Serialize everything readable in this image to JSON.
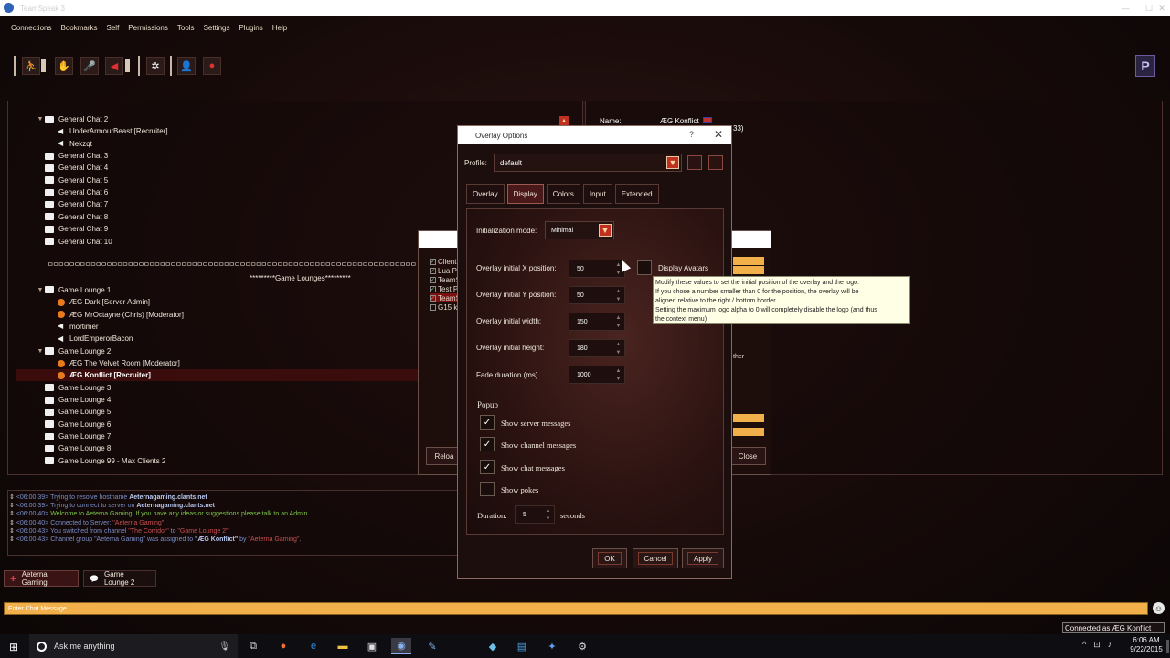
{
  "window": {
    "title": "TeamSpeak 3"
  },
  "menu": [
    "Connections",
    "Bookmarks",
    "Self",
    "Permissions",
    "Tools",
    "Settings",
    "Plugins",
    "Help"
  ],
  "toolbar": {
    "icons": [
      "connect-icon",
      "away-icon",
      "mic-mute-icon",
      "speaker-mute-icon",
      "settings-icon",
      "contacts-icon",
      "record-icon"
    ]
  },
  "pbutton": "P",
  "tree": [
    {
      "type": "channel",
      "label": "General Chat 2",
      "indent": 0,
      "expand": "▼"
    },
    {
      "type": "user",
      "label": "UnderArmourBeast [Recruiter]",
      "indent": 1
    },
    {
      "type": "user",
      "label": "Nekzqt",
      "indent": 1
    },
    {
      "type": "channel",
      "label": "General Chat 3",
      "indent": 0
    },
    {
      "type": "channel",
      "label": "General Chat 4",
      "indent": 0
    },
    {
      "type": "channel",
      "label": "General Chat 5",
      "indent": 0
    },
    {
      "type": "channel",
      "label": "General Chat 6",
      "indent": 0
    },
    {
      "type": "channel",
      "label": "General Chat 7",
      "indent": 0
    },
    {
      "type": "channel",
      "label": "General Chat 8",
      "indent": 0
    },
    {
      "type": "channel",
      "label": "General Chat 9",
      "indent": 0
    },
    {
      "type": "channel",
      "label": "General Chat 10",
      "indent": 0
    },
    {
      "type": "spacer",
      "label": ""
    },
    {
      "type": "banner",
      "label": "ᄆᄆᄆᄆᄆᄆᄆᄆᄆᄆᄆᄆᄆᄆᄆᄆᄆᄆᄆᄆᄆᄆᄆᄆᄆᄆᄆᄆᄆᄆᄆᄆᄆᄆᄆᄆᄆᄆᄆᄆᄆᄆᄆᄆᄆᄆᄆᄆᄆᄆᄆᄆᄆᄆᄆᄆᄆᄆᄆᄆᄆᄆᄆᄆᄆᄆᄆᄆᄆ"
    },
    {
      "type": "banner2",
      "label": "*********Game Lounges*********"
    },
    {
      "type": "channel",
      "label": "Game Lounge 1",
      "indent": 0,
      "expand": "▼"
    },
    {
      "type": "orange",
      "label": "ÆG Dark [Server Admin]",
      "indent": 1
    },
    {
      "type": "orange",
      "label": "ÆG MrOctayne (Chris) [Moderator]",
      "indent": 1
    },
    {
      "type": "user",
      "label": "mortimer",
      "indent": 1
    },
    {
      "type": "user",
      "label": "LordEmperorBacon",
      "indent": 1
    },
    {
      "type": "channel",
      "label": "Game Lounge 2",
      "indent": 0,
      "expand": "▼"
    },
    {
      "type": "orange",
      "label": "ÆG The Velvet Room [Moderator]",
      "indent": 1
    },
    {
      "type": "orange-sel",
      "label": "ÆG Konflict [Recruiter]",
      "indent": 1
    },
    {
      "type": "channel",
      "label": "Game Lounge 3",
      "indent": 0
    },
    {
      "type": "channel",
      "label": "Game Lounge 4",
      "indent": 0
    },
    {
      "type": "channel",
      "label": "Game Lounge 5",
      "indent": 0
    },
    {
      "type": "channel",
      "label": "Game Lounge 6",
      "indent": 0
    },
    {
      "type": "channel",
      "label": "Game Lounge 7",
      "indent": 0
    },
    {
      "type": "channel",
      "label": "Game Lounge 8",
      "indent": 0
    },
    {
      "type": "channel",
      "label": "Game Lounge 99 - Max Clients 2",
      "indent": 0
    }
  ],
  "log": [
    {
      "ts": "<06:00:39>",
      "parts": [
        {
          "t": " Trying to resolve hostname ",
          "c": ""
        },
        {
          "t": "Aeternagaming.clants.net",
          "c": "b"
        }
      ]
    },
    {
      "ts": "<06:00:39>",
      "parts": [
        {
          "t": " Trying to connect to server on ",
          "c": ""
        },
        {
          "t": "Aeternagaming.clants.net",
          "c": "b"
        }
      ]
    },
    {
      "ts": "<06:00:40>",
      "parts": [
        {
          "t": " Welcome to Aeterna Gaming! If you have any ideas or suggestions please talk to an Admin.",
          "c": "g"
        }
      ]
    },
    {
      "ts": "<06:00:40>",
      "parts": [
        {
          "t": " Connected to Server: ",
          "c": ""
        },
        {
          "t": "\"Aeterna Gaming\"",
          "c": "r"
        }
      ]
    },
    {
      "ts": "<06:00:43>",
      "parts": [
        {
          "t": " You switched from channel ",
          "c": ""
        },
        {
          "t": "\"The Corridor\"",
          "c": "r"
        },
        {
          "t": " to ",
          "c": ""
        },
        {
          "t": "\"Game Lounge 2\"",
          "c": "r"
        }
      ]
    },
    {
      "ts": "<06:00:43>",
      "parts": [
        {
          "t": " Channel group \"Aeterna Gaming\" was assigned to ",
          "c": ""
        },
        {
          "t": "\"ÆG Konflict\"",
          "c": "b"
        },
        {
          "t": " by ",
          "c": ""
        },
        {
          "t": "\"Aeterna Gaming\"",
          "c": "r"
        },
        {
          "t": ".",
          "c": ""
        }
      ]
    }
  ],
  "server_tabs": [
    {
      "label": "Aeterna Gaming",
      "active": true
    },
    {
      "label": "Game Lounge 2",
      "active": false
    }
  ],
  "chat_input": {
    "placeholder": "Enter Chat Message..."
  },
  "status": {
    "connected": "Connected as ÆG Konflict"
  },
  "right_panel": {
    "name_label": "Name:",
    "name_value": "ÆG Konflict",
    "partial_33": "33)"
  },
  "bg_dialog": {
    "items": [
      "Client",
      "Lua P",
      "TeamS",
      "Test P",
      "TeamS",
      "G15 k"
    ],
    "reload": "Reloa",
    "close": "Close",
    "side": "ther"
  },
  "overlay_dialog": {
    "title": "Overlay Options",
    "help": "?",
    "close": "✕",
    "profile_label": "Profile:",
    "profile_value": "default",
    "tabs": [
      "Overlay",
      "Display",
      "Colors",
      "Input",
      "Extended"
    ],
    "active_tab": "Display",
    "init_mode_label": "Initialization mode:",
    "init_mode_value": "Minimal",
    "fields": [
      {
        "label": "Overlay initial X position:",
        "value": "50"
      },
      {
        "label": "Overlay initial Y position:",
        "value": "50"
      },
      {
        "label": "Overlay initial width:",
        "value": "150"
      },
      {
        "label": "Overlay initial height:",
        "value": "180"
      },
      {
        "label": "Fade duration (ms)",
        "value": "1000"
      }
    ],
    "display_avatars": "Display Avatars",
    "popup_heading": "Popup",
    "popup_items": [
      {
        "label": "Show server messages",
        "checked": true
      },
      {
        "label": "Show channel messages",
        "checked": true
      },
      {
        "label": "Show chat messages",
        "checked": true
      },
      {
        "label": "Show pokes",
        "checked": false
      }
    ],
    "duration_label": "Duration:",
    "duration_value": "5",
    "duration_unit": "seconds",
    "ok": "OK",
    "cancel": "Cancel",
    "apply": "Apply",
    "tooltip": [
      "Modify these values to set the initial position of the overlay and the logo.",
      "If you chose a number smaller than 0 for the position, the overlay will be",
      "aligned relative to the right / bottom border.",
      "Setting the maximum logo alpha to 0 will completely disable the logo (and thus",
      "the context menu)"
    ]
  },
  "taskbar": {
    "search_placeholder": "Ask me anything",
    "time": "6:06 AM",
    "date": "9/22/2015"
  }
}
